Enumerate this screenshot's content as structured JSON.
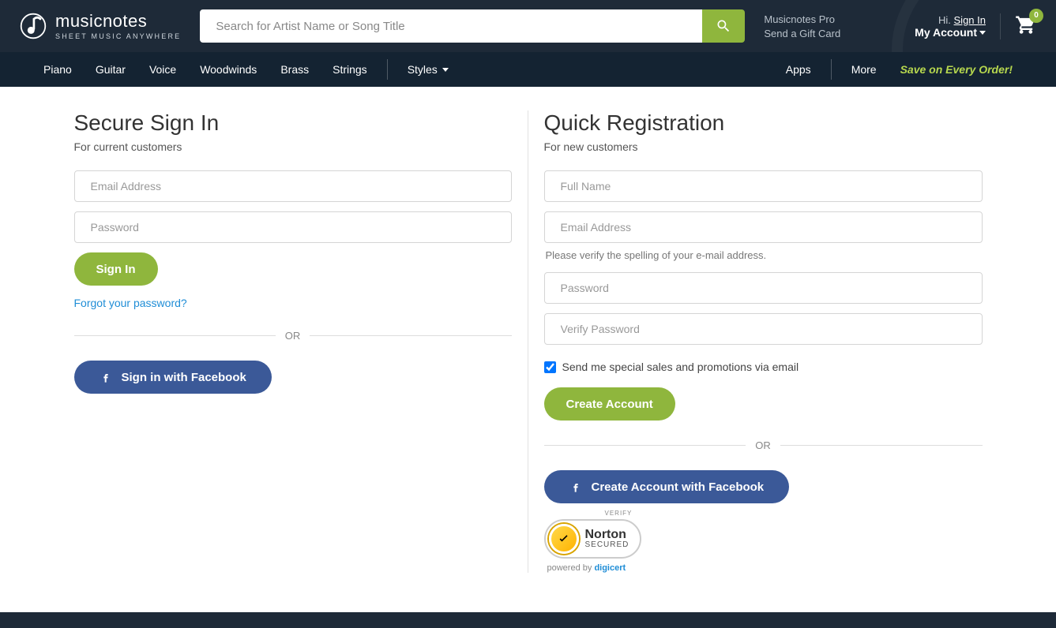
{
  "header": {
    "brand": "musicnotes",
    "tagline": "SHEET MUSIC ANYWHERE",
    "search_placeholder": "Search for Artist Name or Song Title",
    "pro_link": "Musicnotes Pro",
    "gift_link": "Send a Gift Card",
    "greeting": "Hi.",
    "sign_in": "Sign In",
    "my_account": "My Account",
    "cart_count": "0"
  },
  "nav": {
    "items": [
      "Piano",
      "Guitar",
      "Voice",
      "Woodwinds",
      "Brass",
      "Strings"
    ],
    "styles": "Styles",
    "apps": "Apps",
    "more": "More",
    "save": "Save on Every Order!"
  },
  "signin": {
    "title": "Secure Sign In",
    "subtitle": "For current customers",
    "email_ph": "Email Address",
    "password_ph": "Password",
    "button": "Sign In",
    "forgot": "Forgot your password?",
    "or": "OR",
    "fb": "Sign in with Facebook"
  },
  "register": {
    "title": "Quick Registration",
    "subtitle": "For new customers",
    "name_ph": "Full Name",
    "email_ph": "Email Address",
    "email_hint": "Please verify the spelling of your e-mail address.",
    "password_ph": "Password",
    "verify_ph": "Verify Password",
    "promo_label": "Send me special sales and promotions via email",
    "button": "Create Account",
    "or": "OR",
    "fb": "Create Account with Facebook"
  },
  "norton": {
    "verify": "VERIFY",
    "name": "Norton",
    "secured": "SECURED",
    "powered": "powered by",
    "digicert": "digicert"
  }
}
